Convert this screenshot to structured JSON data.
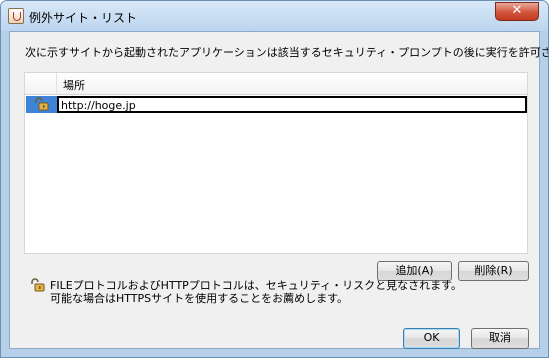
{
  "window": {
    "title": "例外サイト・リスト",
    "close_label": "✕"
  },
  "dialog": {
    "instructions": "次に示すサイトから起動されたアプリケーションは該当するセキュリティ・プロンプトの後に実行を許可されます。",
    "table": {
      "header_location": "場所",
      "rows": [
        {
          "url": "http://hoge.jp",
          "icon": "open-lock-icon"
        }
      ]
    },
    "add_label": "追加(A)",
    "remove_label": "削除(R)",
    "warning_line1": "FILEプロトコルおよびHTTPプロトコルは、セキュリティ・リスクと見なされます。",
    "warning_line2": "可能な場合はHTTPSサイトを使用することをお薦めします。",
    "ok_label": "OK",
    "cancel_label": "取消"
  },
  "colors": {
    "selection": "#3d83d6",
    "title_bar": "#c9ddf1",
    "close_button": "#d2553b"
  }
}
